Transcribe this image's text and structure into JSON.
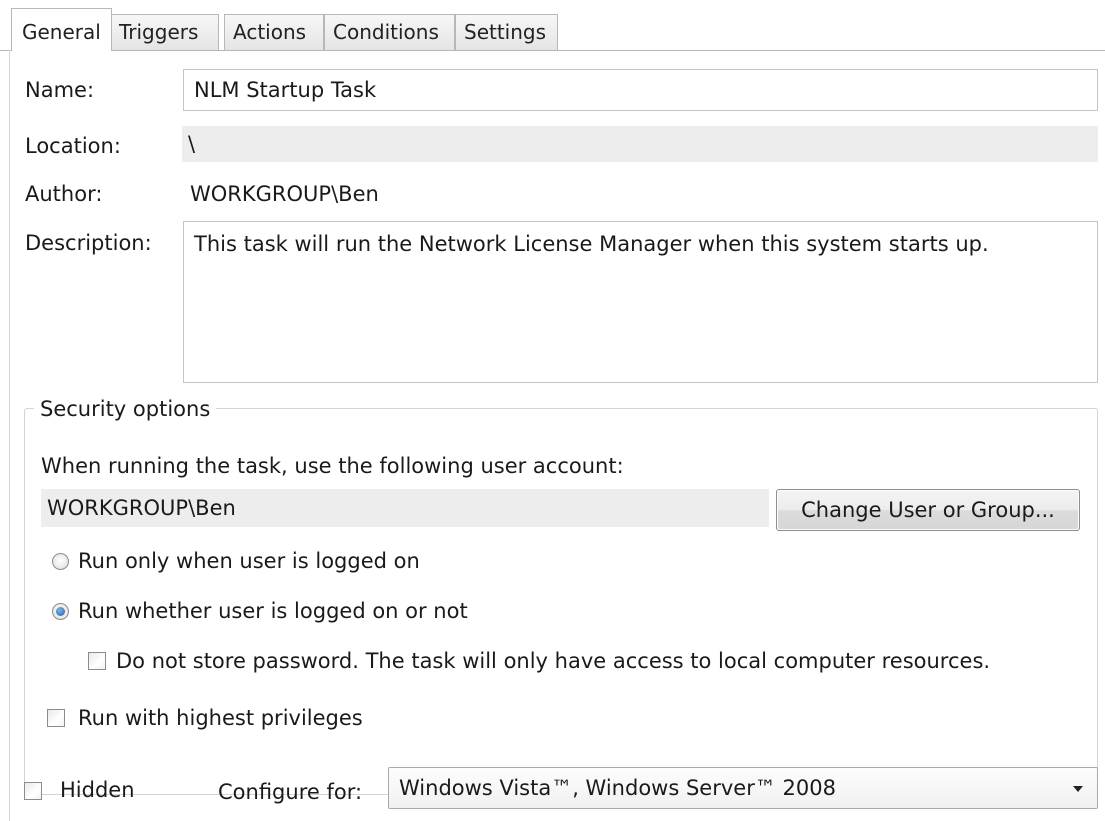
{
  "tabs": [
    {
      "label": "General",
      "active": true
    },
    {
      "label": "Triggers",
      "active": false
    },
    {
      "label": "Actions",
      "active": false
    },
    {
      "label": "Conditions",
      "active": false
    },
    {
      "label": "Settings",
      "active": false
    }
  ],
  "fields": {
    "name_label": "Name:",
    "name_value": "NLM Startup Task",
    "location_label": "Location:",
    "location_value": "\\",
    "author_label": "Author:",
    "author_value": "WORKGROUP\\Ben",
    "description_label": "Description:",
    "description_value": "This task will run the Network License Manager when this system starts up."
  },
  "security": {
    "title": "Security options",
    "account_prompt": "When running the task, use the following user account:",
    "account_value": "WORKGROUP\\Ben",
    "change_button": "Change User or Group...",
    "radio_logged_on": "Run only when user is logged on",
    "radio_logged_on_selected": false,
    "radio_whether": "Run whether user is logged on or not",
    "radio_whether_selected": true,
    "no_store_password": "Do not store password.  The task will only have access to local computer resources.",
    "no_store_password_checked": false,
    "highest_privileges": "Run with highest privileges",
    "highest_privileges_checked": false
  },
  "bottom": {
    "hidden_label": "Hidden",
    "hidden_checked": false,
    "configure_label": "Configure for:",
    "configure_value": "Windows Vista™, Windows Server™ 2008"
  },
  "colors": {
    "radio_selected": "#1d5ea6",
    "readonly_bg": "#ededed"
  }
}
